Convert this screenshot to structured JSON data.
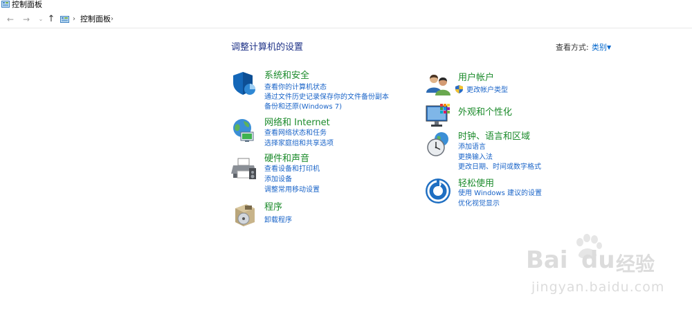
{
  "window": {
    "title": "控制面板"
  },
  "breadcrumb": {
    "path": "控制面板"
  },
  "page": {
    "title": "调整计算机的设置"
  },
  "view_by": {
    "label": "查看方式:",
    "value": "类别"
  },
  "categories_left": [
    {
      "name": "系统和安全",
      "links": [
        "查看你的计算机状态",
        "通过文件历史记录保存你的文件备份副本",
        "备份和还原(Windows 7)"
      ]
    },
    {
      "name": "网络和 Internet",
      "links": [
        "查看网络状态和任务",
        "选择家庭组和共享选项"
      ]
    },
    {
      "name": "硬件和声音",
      "links": [
        "查看设备和打印机",
        "添加设备",
        "调整常用移动设置"
      ]
    },
    {
      "name": "程序",
      "links": [
        "卸载程序"
      ]
    }
  ],
  "categories_right": [
    {
      "name": "用户帐户",
      "links": [
        "更改帐户类型"
      ]
    },
    {
      "name": "外观和个性化",
      "links": []
    },
    {
      "name": "时钟、语言和区域",
      "links": [
        "添加语言",
        "更换输入法",
        "更改日期、时间或数字格式"
      ]
    },
    {
      "name": "轻松使用",
      "links": [
        "使用 Windows 建议的设置",
        "优化视觉显示"
      ]
    }
  ],
  "watermark": {
    "brand": "Bai",
    "brand2": "du",
    "cn": "经验",
    "url": "jingyan.baidu.com"
  },
  "colors": {
    "heading_green": "#1a8a2a",
    "link_blue": "#1a64c8",
    "title_blue": "#1e3287"
  },
  "icons": [
    "back-arrow-icon",
    "forward-arrow-icon",
    "recent-dropdown-icon",
    "up-arrow-icon",
    "control-panel-icon",
    "chevron-right-icon",
    "shield-icon",
    "globe-network-icon",
    "printer-icon",
    "programs-box-icon",
    "users-icon",
    "uac-shield-icon",
    "monitor-palette-icon",
    "clock-globe-icon",
    "ease-of-access-icon"
  ]
}
